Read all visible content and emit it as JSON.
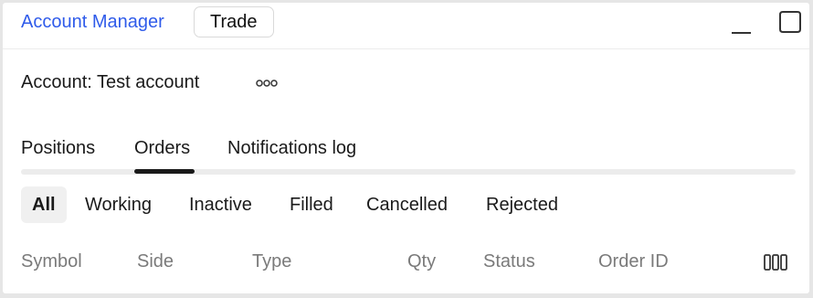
{
  "header": {
    "title": "Account Manager",
    "trade_label": "Trade",
    "minimize_icon": "minimize-icon",
    "maximize_icon": "maximize-icon"
  },
  "account": {
    "label": "Account: Test account",
    "more_icon": "more-options-icon"
  },
  "tabs": [
    {
      "label": "Positions",
      "active": false
    },
    {
      "label": "Orders",
      "active": true
    },
    {
      "label": "Notifications log",
      "active": false
    }
  ],
  "filters": [
    {
      "label": "All",
      "active": true
    },
    {
      "label": "Working",
      "active": false
    },
    {
      "label": "Inactive",
      "active": false
    },
    {
      "label": "Filled",
      "active": false
    },
    {
      "label": "Cancelled",
      "active": false
    },
    {
      "label": "Rejected",
      "active": false
    }
  ],
  "columns": [
    "Symbol",
    "Side",
    "Type",
    "Qty",
    "Status",
    "Order ID"
  ],
  "column_settings_icon": "columns-icon",
  "colors": {
    "accent": "#2f5bea",
    "muted_text": "#7a7a7a",
    "active_filter_bg": "#f0f0f0"
  }
}
